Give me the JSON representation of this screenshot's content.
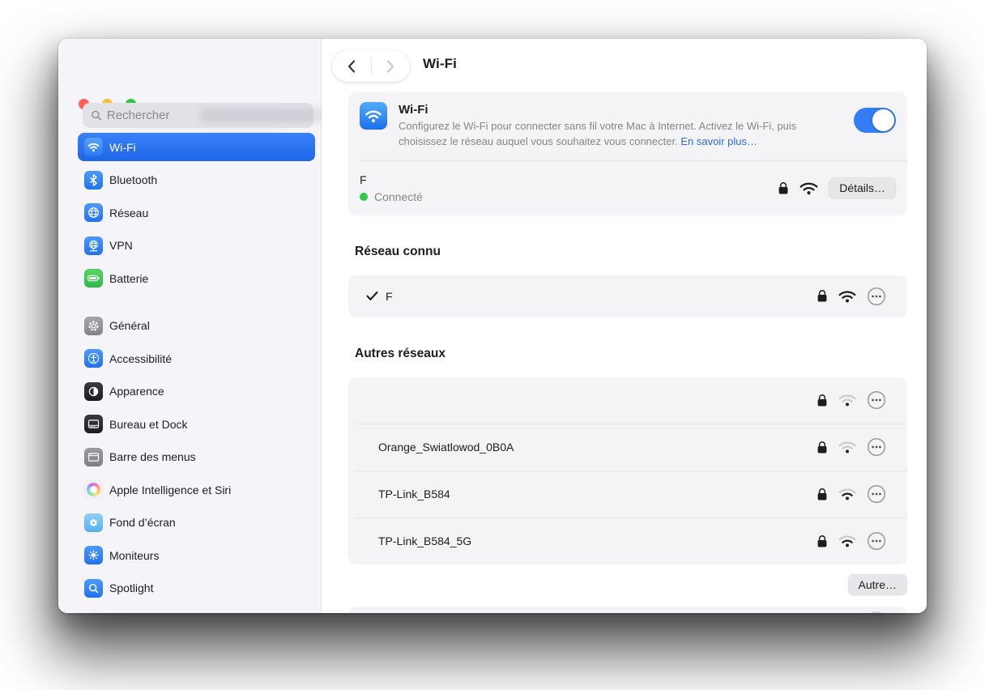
{
  "header": {
    "title": "Wi-Fi"
  },
  "sidebar": {
    "search_placeholder": "Rechercher",
    "groups": [
      {
        "items": [
          {
            "label": "Wi-Fi",
            "selected": true
          },
          {
            "label": "Bluetooth"
          },
          {
            "label": "Réseau"
          },
          {
            "label": "VPN"
          },
          {
            "label": "Batterie"
          }
        ]
      },
      {
        "items": [
          {
            "label": "Général"
          },
          {
            "label": "Accessibilité"
          },
          {
            "label": "Apparence"
          },
          {
            "label": "Bureau et Dock"
          },
          {
            "label": "Barre des menus"
          },
          {
            "label": "Apple Intelligence et Siri"
          },
          {
            "label": "Fond d’écran"
          },
          {
            "label": "Moniteurs"
          },
          {
            "label": "Spotlight"
          }
        ]
      }
    ]
  },
  "wifi_section": {
    "title": "Wi-Fi",
    "description": "Configurez le Wi-Fi pour connecter sans fil votre Mac à Internet. Activez le Wi-Fi, puis choisissez le réseau auquel vous souhaitez vous connecter. ",
    "learn_more": "En savoir plus…",
    "toggle_state": "on",
    "connected": {
      "name": "F",
      "status": "Connecté",
      "details_label": "Détails…"
    }
  },
  "known_network": {
    "heading": "Réseau connu",
    "rows": [
      {
        "name": "F",
        "checked": true,
        "secured": true,
        "signal": 3
      }
    ]
  },
  "other_networks": {
    "heading": "Autres réseaux",
    "rows": [
      {
        "name": "",
        "secured": true,
        "signal": 1
      },
      {
        "name": "Orange_Swiatlowod_0B0A",
        "secured": true,
        "signal": 1
      },
      {
        "name": "TP-Link_B584",
        "secured": true,
        "signal": 2
      },
      {
        "name": "TP-Link_B584_5G",
        "secured": true,
        "signal": 2
      }
    ],
    "other_button": "Autre…"
  },
  "colors": {
    "accent": "#2b6ceb",
    "toggle_on": "#357df6",
    "link": "#2d6be5",
    "connected_dot": "#30c94c"
  }
}
